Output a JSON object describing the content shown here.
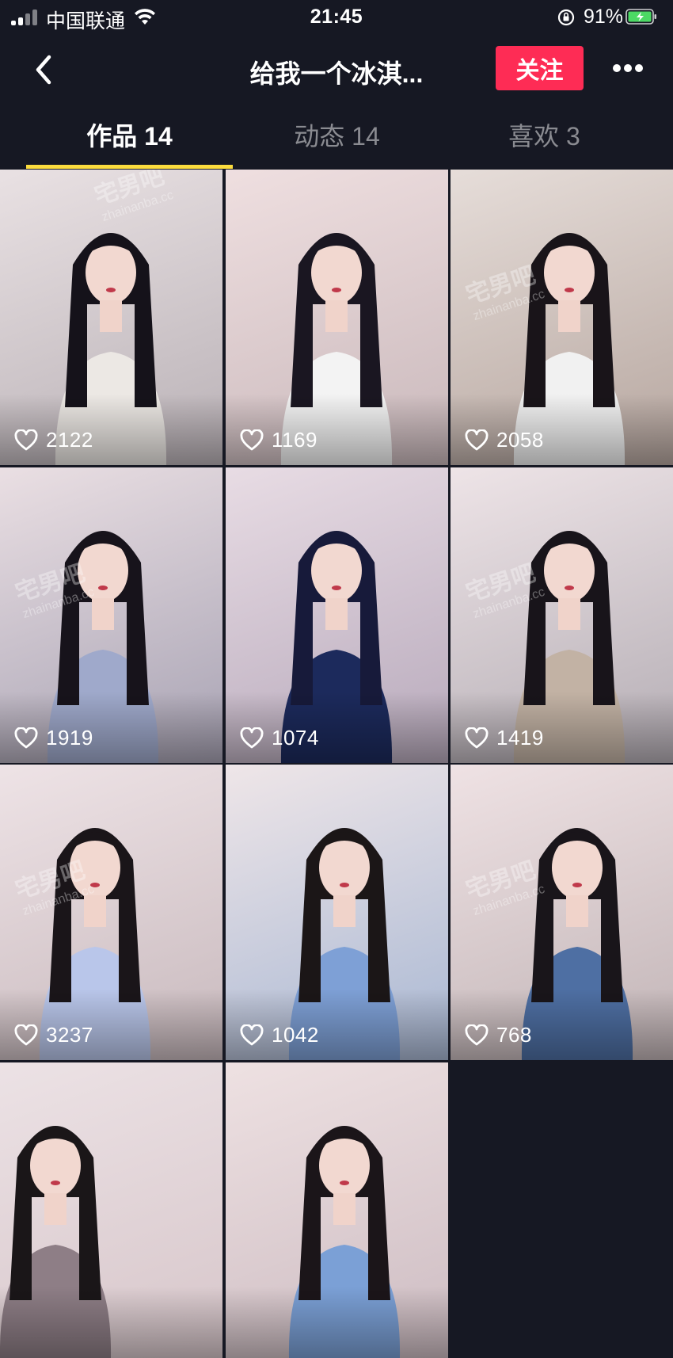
{
  "status_bar": {
    "carrier": "中国联通",
    "time": "21:45",
    "battery_percent": "91%"
  },
  "header": {
    "title": "给我一个冰淇...",
    "follow_label": "关注"
  },
  "tabs": [
    {
      "label": "作品 14",
      "active": true
    },
    {
      "label": "动态 14",
      "active": false
    },
    {
      "label": "喜欢 3",
      "active": false
    }
  ],
  "videos": [
    {
      "likes": "2122",
      "palette": [
        "#e9e1e3",
        "#b9b1b6"
      ],
      "icon": "heart-outline-icon"
    },
    {
      "likes": "1169",
      "palette": [
        "#efdfe0",
        "#c9b8bb"
      ],
      "icon": "heart-outline-icon"
    },
    {
      "likes": "2058",
      "palette": [
        "#e6ddd9",
        "#b6a69f"
      ],
      "icon": "heart-outline-icon"
    },
    {
      "likes": "1919",
      "palette": [
        "#eadfe3",
        "#a7a2b3"
      ],
      "icon": "heart-outline-icon"
    },
    {
      "likes": "1074",
      "palette": [
        "#e8dce4",
        "#b7a9bb"
      ],
      "icon": "heart-outline-icon"
    },
    {
      "likes": "1419",
      "palette": [
        "#eee4e7",
        "#b4adb4"
      ],
      "icon": "heart-outline-icon"
    },
    {
      "likes": "3237",
      "palette": [
        "#eee3e6",
        "#c8b9bd"
      ],
      "icon": "heart-outline-icon"
    },
    {
      "likes": "1042",
      "palette": [
        "#efe6e8",
        "#a8b7d3"
      ],
      "icon": "heart-outline-icon"
    },
    {
      "likes": "768",
      "palette": [
        "#efe2e4",
        "#c1b4b6"
      ],
      "icon": "heart-outline-icon"
    },
    {
      "likes": "",
      "palette": [
        "#ece2e5",
        "#d7c6ca"
      ],
      "icon": "heart-outline-icon"
    },
    {
      "likes": "",
      "palette": [
        "#eee1e2",
        "#cdbcc2"
      ],
      "icon": "heart-outline-icon"
    }
  ],
  "watermark": {
    "text": "宅男吧",
    "sub": "zhainanba.cc"
  },
  "colors": {
    "background": "#161823",
    "follow_button": "#fe2c55",
    "tab_indicator": "#fcdc3e",
    "inactive_tab": "#8a8b91"
  }
}
